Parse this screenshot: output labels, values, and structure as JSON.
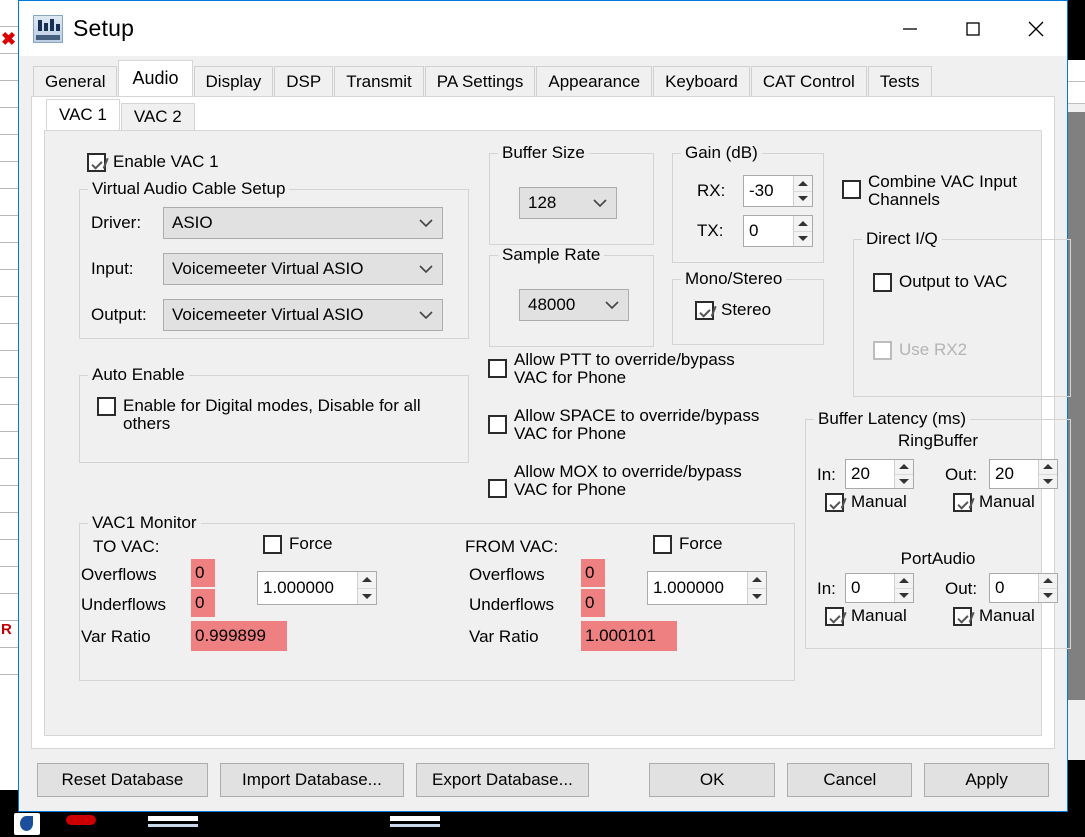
{
  "window": {
    "title": "Setup",
    "icon": "app-waveform-icon",
    "controls": {
      "minimize": "minimize-icon",
      "maximize": "maximize-icon",
      "close": "close-icon"
    }
  },
  "tabs": [
    {
      "label": "General",
      "active": false
    },
    {
      "label": "Audio",
      "active": true
    },
    {
      "label": "Display",
      "active": false
    },
    {
      "label": "DSP",
      "active": false
    },
    {
      "label": "Transmit",
      "active": false
    },
    {
      "label": "PA Settings",
      "active": false
    },
    {
      "label": "Appearance",
      "active": false
    },
    {
      "label": "Keyboard",
      "active": false
    },
    {
      "label": "CAT Control",
      "active": false
    },
    {
      "label": "Tests",
      "active": false
    }
  ],
  "subtabs": [
    {
      "label": "VAC 1",
      "active": true
    },
    {
      "label": "VAC 2",
      "active": false
    }
  ],
  "audio": {
    "enable_vac1": {
      "label": "Enable VAC 1",
      "checked": true
    },
    "vac_setup": {
      "caption": "Virtual Audio Cable Setup",
      "driver_label": "Driver:",
      "driver_value": "ASIO",
      "input_label": "Input:",
      "input_value": "Voicemeeter Virtual ASIO",
      "output_label": "Output:",
      "output_value": "Voicemeeter Virtual ASIO"
    },
    "auto_enable": {
      "caption": "Auto Enable",
      "checkbox_label": "Enable for Digital modes, Disable for all others",
      "checked": false
    },
    "buffer_size": {
      "caption": "Buffer Size",
      "value": "128"
    },
    "sample_rate": {
      "caption": "Sample Rate",
      "value": "48000"
    },
    "gain": {
      "caption": "Gain (dB)",
      "rx_label": "RX:",
      "rx_value": "-30",
      "tx_label": "TX:",
      "tx_value": "0"
    },
    "mono_stereo": {
      "caption": "Mono/Stereo",
      "stereo_label": "Stereo",
      "stereo_checked": true
    },
    "overrides": [
      {
        "label": "Allow PTT to override/bypass VAC for Phone",
        "checked": false
      },
      {
        "label": "Allow SPACE to override/bypass VAC for Phone",
        "checked": false
      },
      {
        "label": "Allow MOX to override/bypass VAC for Phone",
        "checked": false
      }
    ],
    "combine_vac": {
      "label": "Combine VAC Input Channels",
      "checked": false
    },
    "direct_iq": {
      "caption": "Direct I/Q",
      "output_to_vac": {
        "label": "Output to VAC",
        "checked": false
      },
      "use_rx2": {
        "label": "Use RX2",
        "checked": false,
        "disabled": true
      }
    },
    "buffer_latency": {
      "caption": "Buffer Latency (ms)",
      "ringbuffer": {
        "title": "RingBuffer",
        "in_label": "In:",
        "in_value": "20",
        "in_manual_label": "Manual",
        "in_manual_checked": true,
        "out_label": "Out:",
        "out_value": "20",
        "out_manual_label": "Manual",
        "out_manual_checked": true
      },
      "portaudio": {
        "title": "PortAudio",
        "in_label": "In:",
        "in_value": "0",
        "in_manual_label": "Manual",
        "in_manual_checked": true,
        "out_label": "Out:",
        "out_value": "0",
        "out_manual_label": "Manual",
        "out_manual_checked": true
      }
    },
    "monitor": {
      "caption": "VAC1 Monitor",
      "to_vac": {
        "title": "TO VAC:",
        "force_label": "Force",
        "force_checked": false,
        "ratio_value": "1.000000",
        "overflows_label": "Overflows",
        "overflows_value": "0",
        "underflows_label": "Underflows",
        "underflows_value": "0",
        "var_ratio_label": "Var Ratio",
        "var_ratio_value": "0.999899"
      },
      "from_vac": {
        "title": "FROM VAC:",
        "force_label": "Force",
        "force_checked": false,
        "ratio_value": "1.000000",
        "overflows_label": "Overflows",
        "overflows_value": "0",
        "underflows_label": "Underflows",
        "underflows_value": "0",
        "var_ratio_label": "Var Ratio",
        "var_ratio_value": "1.000101"
      }
    }
  },
  "buttons": {
    "reset_database": "Reset Database",
    "import_database": "Import Database...",
    "export_database": "Export Database...",
    "ok": "OK",
    "cancel": "Cancel",
    "apply": "Apply"
  },
  "colors": {
    "accent": "#0078d7",
    "alert_field": "#ef8081",
    "dialog_bg": "#f0f0f0",
    "panel_bg": "#ffffff"
  }
}
